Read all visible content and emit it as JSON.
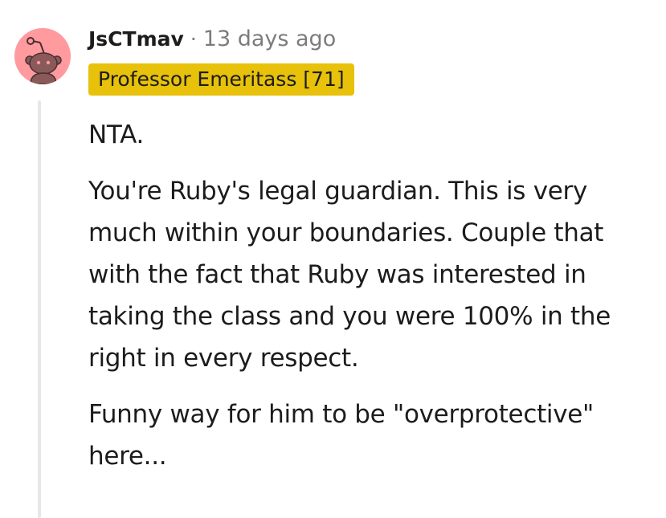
{
  "comment": {
    "username": "JsCTmav",
    "separator": "·",
    "timestamp": "13 days ago",
    "flair": "Professor Emeritass [71]",
    "paragraphs": [
      "NTA.",
      "You're Ruby's legal guardian. This is very much within your boundaries. Couple that with the fact that Ruby was interested in taking the class and you were 100% in the right in every respect.",
      "Funny way for him to be \"overprotective\" here..."
    ]
  },
  "colors": {
    "avatar_background": "#ff9a9e",
    "flair_background": "#e7c10a",
    "meta_text": "#7c7c7c",
    "thread_line": "#e7e7e7"
  },
  "icons": {
    "avatar": "snoo-avatar-icon"
  }
}
